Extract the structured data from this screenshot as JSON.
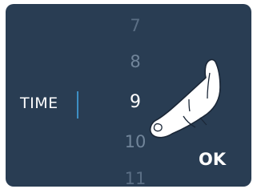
{
  "field": {
    "label": "TIME"
  },
  "picker": {
    "items": [
      "7",
      "8",
      "9",
      "10",
      "11"
    ],
    "selected": "9"
  },
  "actions": {
    "ok_label": "OK"
  },
  "icons": {
    "pointer": "tapping-hand-icon"
  },
  "colors": {
    "background": "#293d53",
    "accent": "#3d8fc4",
    "text": "#ffffff",
    "inactive": "#71859a"
  }
}
